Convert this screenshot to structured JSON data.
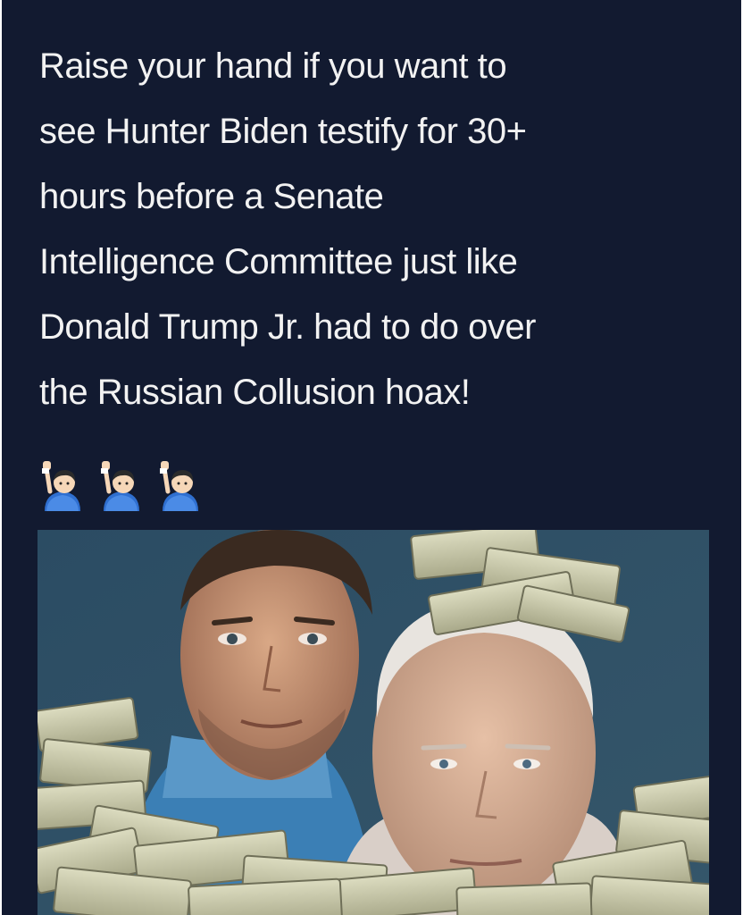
{
  "post": {
    "text": "Raise your hand if you want to\nsee Hunter Biden testify for 30+\nhours before a Senate\nIntelligence Committee just like\nDonald Trump Jr. had to do over\nthe Russian Collusion hoax!"
  },
  "emojis": [
    {
      "icon": "person-raising-hand-icon"
    },
    {
      "icon": "person-raising-hand-icon"
    },
    {
      "icon": "person-raising-hand-icon"
    }
  ],
  "photo": {
    "background_color": "#2d4a5e",
    "description_icons": [
      "younger-man-face",
      "older-man-face",
      "money-stacks"
    ]
  },
  "colors": {
    "background": "#121a30",
    "text": "#f2f2f2",
    "money": "#c9c9a8"
  }
}
